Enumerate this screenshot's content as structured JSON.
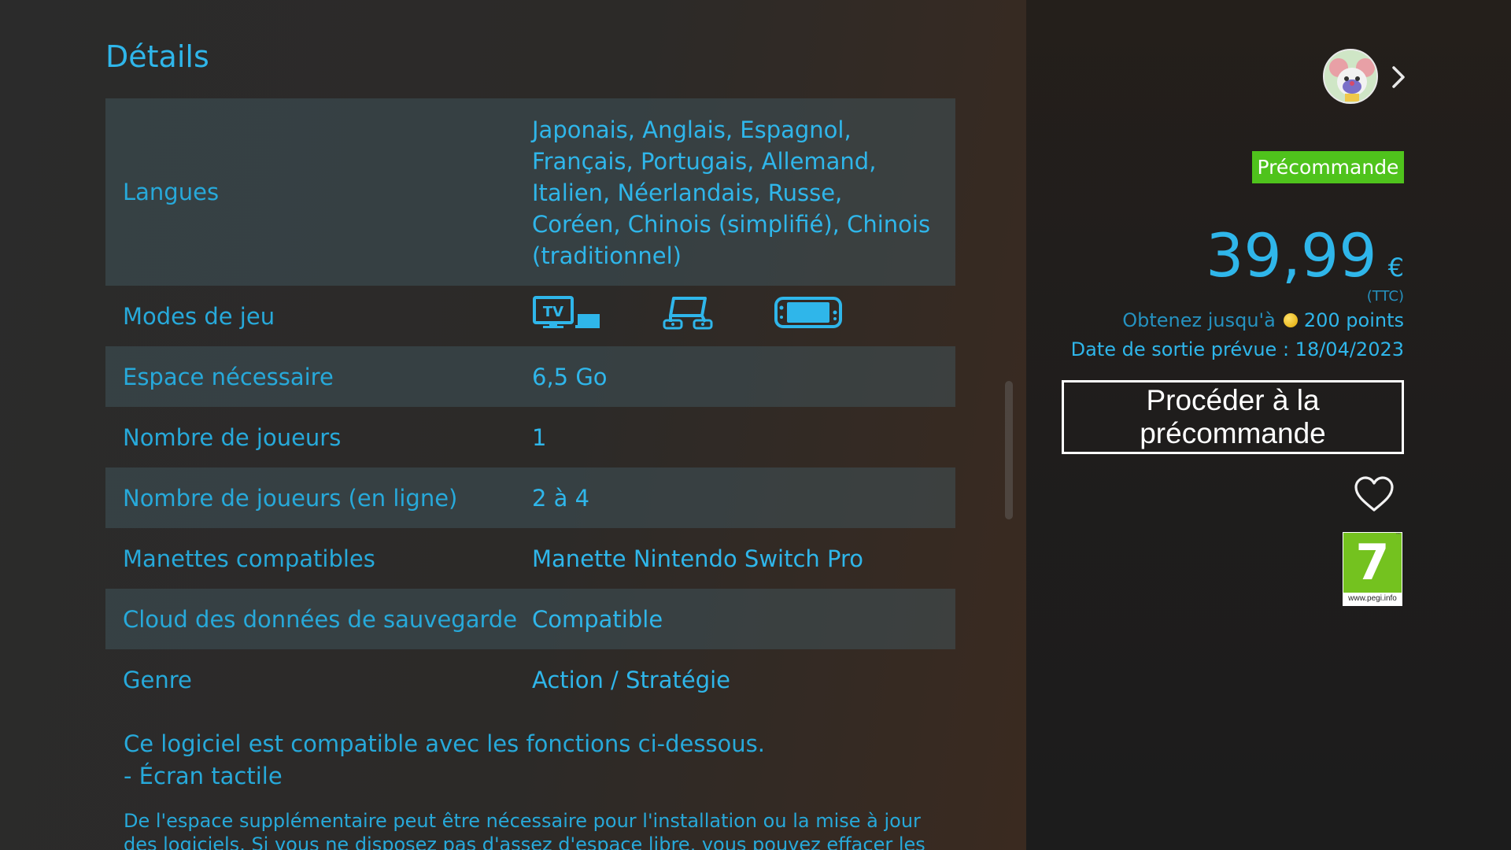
{
  "details": {
    "title": "Détails",
    "rows": [
      {
        "label": "Langues",
        "value": "Japonais, Anglais, Espagnol, Français, Portugais, Allemand, Italien, Néerlandais, Russe, Coréen, Chinois (simplifié), Chinois (traditionnel)"
      },
      {
        "label": "Modes de jeu",
        "value": ""
      },
      {
        "label": "Espace nécessaire",
        "value": "6,5 Go"
      },
      {
        "label": "Nombre de joueurs",
        "value": "1"
      },
      {
        "label": "Nombre de joueurs (en ligne)",
        "value": "2 à 4"
      },
      {
        "label": "Manettes compatibles",
        "value": "Manette Nintendo Switch Pro"
      },
      {
        "label": "Cloud des données de sauvegarde",
        "value": "Compatible"
      },
      {
        "label": "Genre",
        "value": "Action / Stratégie"
      }
    ],
    "play_modes": [
      "tv-mode-icon",
      "tabletop-mode-icon",
      "handheld-mode-icon"
    ],
    "features_line": "Ce logiciel est compatible avec les fonctions ci-dessous.",
    "features_item": "- Écran tactile",
    "footnote": "De l'espace supplémentaire peut être nécessaire pour l'installation ou la mise à jour des logiciels. Si vous ne disposez pas d'assez d'espace libre, vous pouvez effacer les logiciels"
  },
  "sidebar": {
    "badge": "Précommande",
    "price_amount": "39,99",
    "price_currency": "€",
    "price_tax": "(TTC)",
    "points_prefix": "Obtenez jusqu'à",
    "points_value": "200 points",
    "release_date": "Date de sortie prévue : 18/04/2023",
    "preorder_button": "Procéder à la précommande",
    "pegi_rating": "7",
    "pegi_url": "www.pegi.info"
  },
  "colors": {
    "accent": "#2fb6ea",
    "badge_green": "#4fc31c",
    "pegi_green": "#74c21f"
  }
}
